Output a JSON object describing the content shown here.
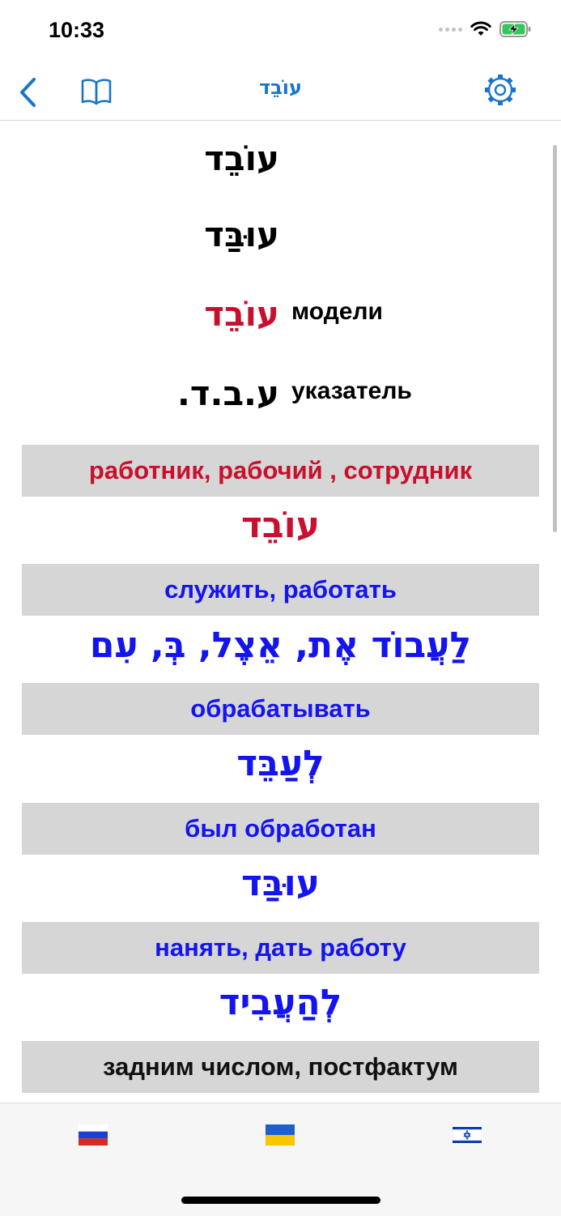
{
  "status": {
    "time": "10:33",
    "battery_color": "#34c759"
  },
  "nav": {
    "title": "עוֹבֵד",
    "back_icon": "chevron-left-icon",
    "dictionary_icon": "book-icon",
    "settings_icon": "gear-icon",
    "accent": "#1a75c9"
  },
  "forms": [
    {
      "hebrew": "עוֹבֵד",
      "label": ""
    },
    {
      "hebrew": "עוּבַּד",
      "label": ""
    },
    {
      "hebrew": "עוֹבֵד",
      "label": "модели"
    },
    {
      "hebrew": "ע.ב.ד.",
      "label": "указатель"
    }
  ],
  "entries": [
    {
      "translation": "работник, рабочий , сотрудник",
      "hebrew": "עוֹבֵד",
      "color": "#c8102e"
    },
    {
      "translation": "служить, работать",
      "hebrew": "לַעֲבוֹד אֶת, אֵצֶל, בְּ, עִם",
      "color": "#1414ee"
    },
    {
      "translation": "обрабатывать",
      "hebrew": "לְעַבֵּד",
      "color": "#1414ee"
    },
    {
      "translation": "был обработан",
      "hebrew": "עוּבַּד",
      "color": "#1414ee"
    },
    {
      "translation": "нанять, дать работу",
      "hebrew": "לְהַעֲבִיד",
      "color": "#1414ee"
    },
    {
      "translation": "задним числом, постфактум",
      "hebrew": "",
      "color": "#111111"
    }
  ],
  "tabs": [
    {
      "icon": "russia-flag-icon"
    },
    {
      "icon": "ukraine-flag-icon"
    },
    {
      "icon": "israel-flag-icon"
    }
  ]
}
